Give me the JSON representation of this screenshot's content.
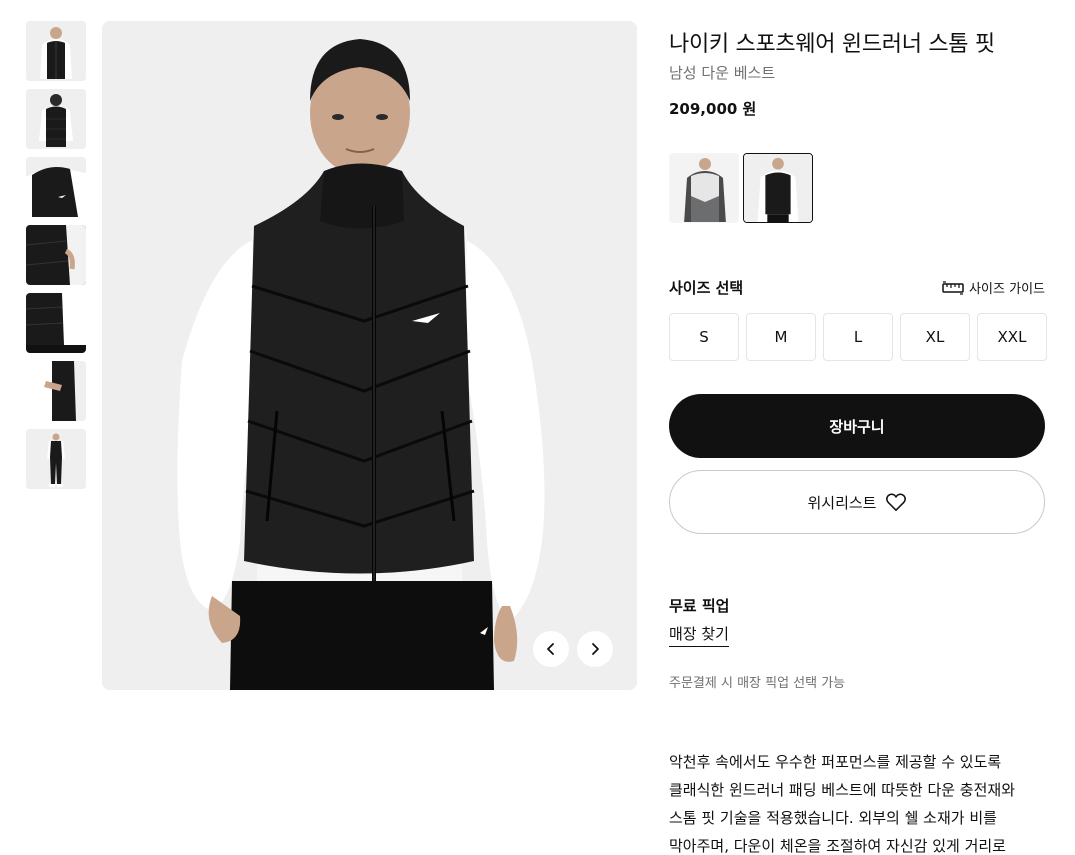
{
  "product": {
    "title": "나이키 스포츠웨어 윈드러너 스톰 핏",
    "subtitle": "남성 다운 베스트",
    "price": "209,000 원"
  },
  "gallery": {
    "thumbnails": [
      "front-view",
      "back-view",
      "chest-logo-closeup",
      "pocket-detail",
      "side-hem-detail",
      "inside-lining",
      "full-body"
    ],
    "selected_index": 0
  },
  "colorways": [
    {
      "name": "grey-white",
      "selected": false
    },
    {
      "name": "black",
      "selected": true
    }
  ],
  "size": {
    "title": "사이즈 선택",
    "guide_label": "사이즈 가이드",
    "options": [
      "S",
      "M",
      "L",
      "XL",
      "XXL"
    ]
  },
  "actions": {
    "cart_label": "장바구니",
    "wishlist_label": "위시리스트"
  },
  "pickup": {
    "title": "무료 픽업",
    "store_link": "매장 찾기",
    "note": "주문결제 시 매장 픽업 선택 가능"
  },
  "description": {
    "lines": [
      "악천후 속에서도 우수한 퍼포먼스를 제공할 수 있도록",
      "클래식한 윈드러너 패딩 베스트에 따뜻한 다운 충전재와",
      "스톰 핏 기술을 적용했습니다. 외부의 쉘 소재가 비를",
      "막아주며, 다운이 체온을 조절하여 자신감 있게 거리로"
    ]
  },
  "colors": {
    "primary": "#111111",
    "muted": "#707072",
    "image_bg": "#efeff0",
    "border": "#e5e5e5"
  },
  "icons": {
    "prev": "chevron-left-icon",
    "next": "chevron-right-icon",
    "size_guide": "ruler-icon",
    "wishlist": "heart-icon"
  }
}
